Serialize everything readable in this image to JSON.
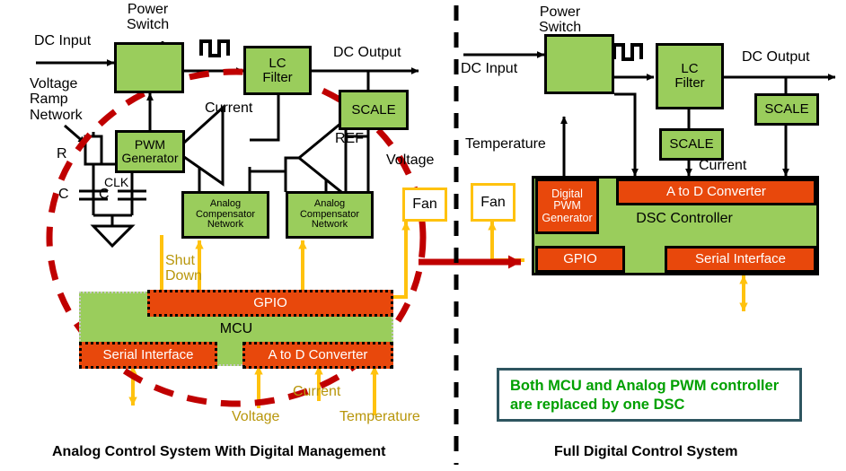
{
  "diagram": {
    "left_panel": {
      "title": "Analog Control System With Digital Management",
      "labels": {
        "dc_input": "DC Input",
        "power_switch": "Power\nSwitch",
        "dc_output": "DC Output",
        "voltage_ramp_network": "Voltage\nRamp\nNetwork",
        "resistor": "R",
        "cap_left": "C",
        "cap_right": "C",
        "clk": "CLK",
        "current": "Current",
        "ref": "REF",
        "voltage_right": "Voltage",
        "shut_down": "Shut\nDown",
        "mcu": "MCU",
        "voltage_bottom": "Voltage",
        "current_bottom": "Current",
        "temperature_bottom": "Temperature"
      },
      "blocks": {
        "power_switch": "",
        "lc_filter": "LC\nFilter",
        "scale": "SCALE",
        "pwm_generator": "PWM\nGenerator",
        "analog_comp_1": "Analog\nCompensator\nNetwork",
        "analog_comp_2": "Analog\nCompensator\nNetwork",
        "fan": "Fan",
        "gpio": "GPIO",
        "serial_interface": "Serial Interface",
        "adc": "A to D Converter"
      }
    },
    "right_panel": {
      "title": "Full Digital Control System",
      "labels": {
        "dc_input": "DC Input",
        "power_switch": "Power\nSwitch",
        "dc_output": "DC Output",
        "temperature": "Temperature",
        "current": "Current"
      },
      "blocks": {
        "lc_filter": "LC\nFilter",
        "scale_output": "SCALE",
        "scale_current": "SCALE",
        "fan": "Fan",
        "digital_pwm_generator": "Digital\nPWM\nGenerator",
        "adc": "A to D Converter",
        "dsc_controller": "DSC Controller",
        "gpio": "GPIO",
        "serial_interface": "Serial Interface"
      },
      "callout": "Both MCU and Analog PWM controller\nare replaced by one DSC"
    },
    "colors": {
      "green_block": "#9ACD5C",
      "orange_block": "#E8480C",
      "fan_border": "#FFC20E",
      "signal_yellow": "#FFC20E",
      "label_gold": "#B8960B",
      "highlight_red": "#C00000",
      "callout_border": "#2E5560",
      "callout_text": "#00A000",
      "wire_black": "#000000"
    }
  }
}
